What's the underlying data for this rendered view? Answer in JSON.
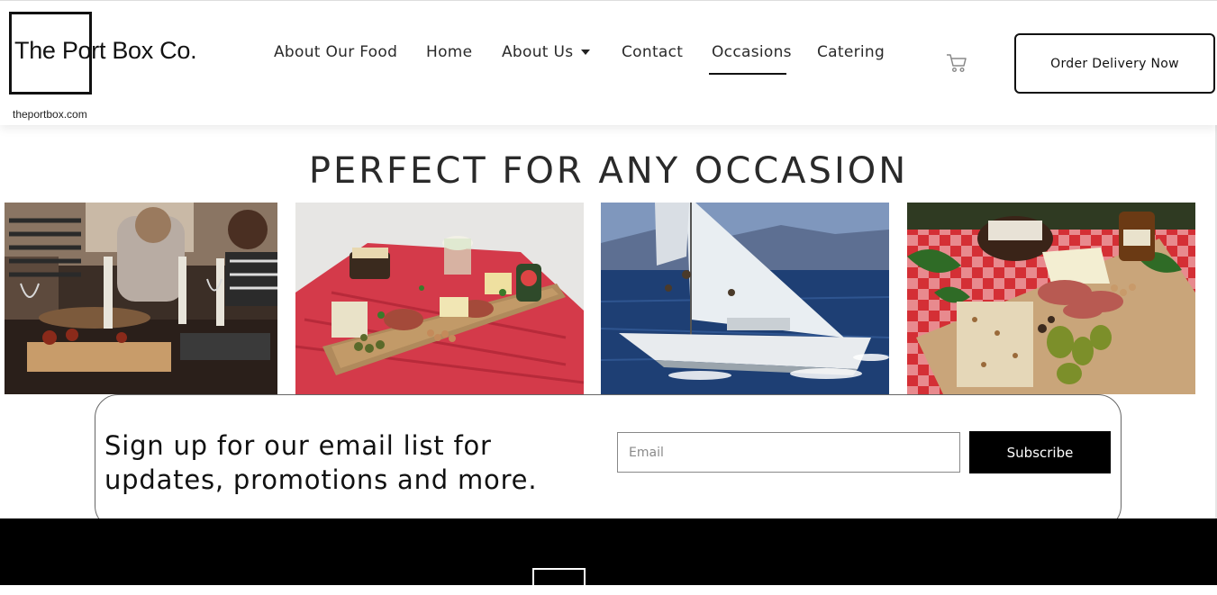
{
  "header": {
    "logo_text": "The Port Box Co.",
    "logo_url": "theportbox.com",
    "nav": [
      {
        "label": "About Our Food"
      },
      {
        "label": "Home"
      },
      {
        "label": "About Us"
      },
      {
        "label": "Contact"
      },
      {
        "label": "Occasions",
        "active": true
      },
      {
        "label": "Catering"
      }
    ],
    "cart_icon": "cart-icon",
    "order_button": "Order Delivery Now"
  },
  "main": {
    "title": "PERFECT FOR ANY OCCASION",
    "photos": [
      {
        "name": "friends-dinner-photo"
      },
      {
        "name": "picnic-charcuterie-photo"
      },
      {
        "name": "sailboat-photo"
      },
      {
        "name": "checkered-charcuterie-photo"
      }
    ]
  },
  "signup": {
    "heading": "Sign up for our email list for updates, promotions and more.",
    "email_placeholder": "Email",
    "subscribe_label": "Subscribe"
  },
  "colors": {
    "accent": "#000000",
    "checkered_red": "#d42f35",
    "blanket_red": "#d43a4a"
  }
}
